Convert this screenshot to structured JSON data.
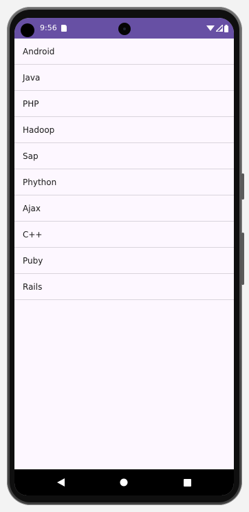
{
  "status_bar": {
    "time": "9:56",
    "background": "#6750a4",
    "icons": [
      "sim-card-icon",
      "wifi-icon",
      "signal-icon",
      "battery-icon"
    ]
  },
  "list": {
    "items": [
      {
        "label": "Android"
      },
      {
        "label": "Java"
      },
      {
        "label": "PHP"
      },
      {
        "label": "Hadoop"
      },
      {
        "label": "Sap"
      },
      {
        "label": "Phython"
      },
      {
        "label": "Ajax"
      },
      {
        "label": "C++"
      },
      {
        "label": "Puby"
      },
      {
        "label": "Rails"
      }
    ]
  },
  "navigation_bar": {
    "buttons": [
      "back-icon",
      "home-icon",
      "recents-icon"
    ]
  },
  "colors": {
    "accent": "#6750a4",
    "screen_background": "#fdf7ff",
    "divider": "#d9d4dc"
  }
}
